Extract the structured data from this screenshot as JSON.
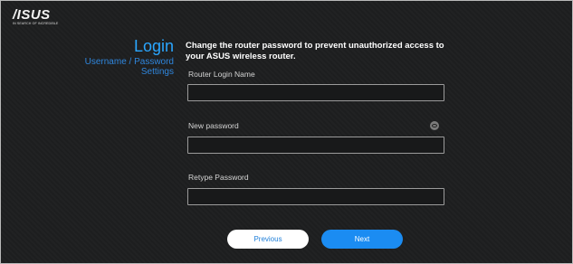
{
  "brand": {
    "logo_text": "/ISUS",
    "tagline": "IN SEARCH OF INCREDIBLE"
  },
  "sidebar": {
    "title": "Login",
    "subtitle_line1": "Username / Password",
    "subtitle_line2": "Settings"
  },
  "form": {
    "description": "Change the router password to prevent unauthorized access to your ASUS wireless router.",
    "fields": [
      {
        "label": "Router Login Name",
        "value": ""
      },
      {
        "label": "New password",
        "value": ""
      },
      {
        "label": "Retype Password",
        "value": ""
      }
    ],
    "show_password_icon": "eye-icon"
  },
  "buttons": {
    "previous": "Previous",
    "next": "Next"
  },
  "colors": {
    "background": "#1d1e1f",
    "accent": "#1b8cf2",
    "title": "#2aa6ff"
  }
}
